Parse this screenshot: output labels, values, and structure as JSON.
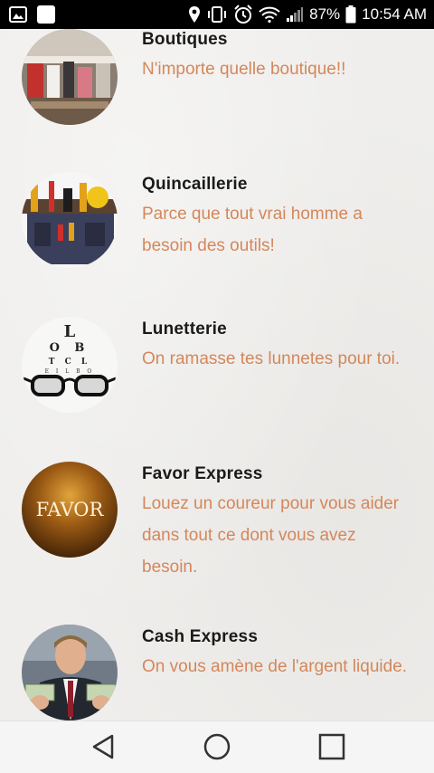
{
  "status_bar": {
    "battery_percent": "87%",
    "time": "10:54 AM",
    "icons": [
      "image-icon",
      "square-icon",
      "location-icon",
      "vibrate-icon",
      "alarm-icon",
      "wifi-icon",
      "signal-icon",
      "battery-icon"
    ]
  },
  "items": [
    {
      "title": "Boutiques",
      "description": "N'importe quelle boutique!!",
      "avatar": "clothing-store-image"
    },
    {
      "title": "Quincaillerie",
      "description": "Parce que tout vrai homme a besoin des outils!",
      "avatar": "tool-belt-image"
    },
    {
      "title": "Lunetterie",
      "description": "On ramasse tes lunnetes pour toi.",
      "avatar": "eye-chart-glasses-image",
      "eye_chart_letters": [
        "L",
        "O B",
        "T C L",
        "E I L B O"
      ]
    },
    {
      "title": "Favor Express",
      "description": "Louez un coureur pour vous aider dans tout ce dont vous avez besoin.",
      "avatar": "favor-logo-image",
      "logo_text": "FAVOR"
    },
    {
      "title": "Cash Express",
      "description": "On vous amène de l'argent liquide.",
      "avatar": "man-with-cash-image"
    }
  ],
  "nav_bar": {
    "buttons": [
      "back",
      "home",
      "recents"
    ]
  },
  "colors": {
    "status_bar_bg": "#000000",
    "title": "#1a1a1a",
    "description": "#d4875a",
    "background": "#efeeec"
  }
}
